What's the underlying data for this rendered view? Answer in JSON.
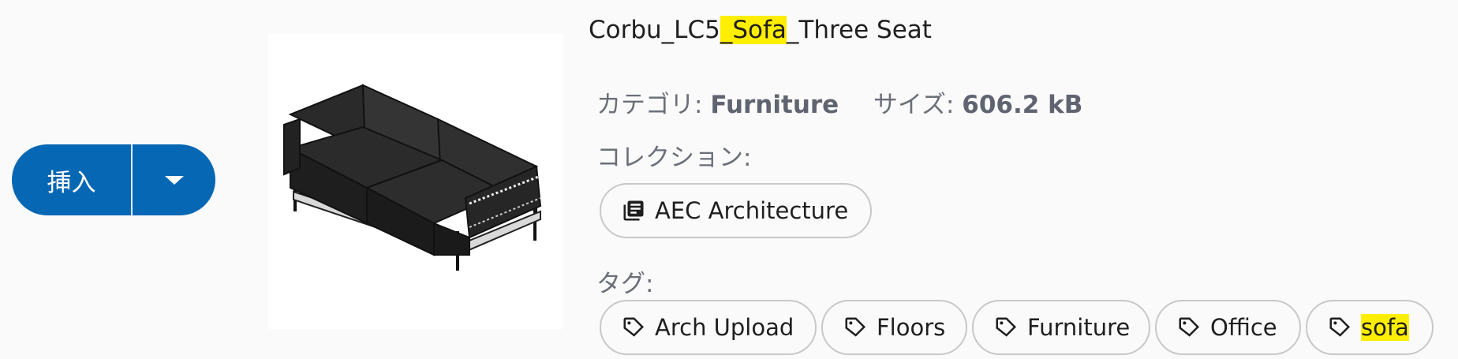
{
  "insert_button": {
    "label": "挿入"
  },
  "asset": {
    "title_prefix": "Corbu_LC5",
    "title_highlight": "_Sofa",
    "title_suffix": "_Three Seat",
    "category_label": "カテゴリ:",
    "category_value": "Furniture",
    "size_label": "サイズ:",
    "size_value": "606.2 kB",
    "collection_label": "コレクション:",
    "tags_label": "タグ:"
  },
  "collections": [
    {
      "label": "AEC Architecture",
      "icon": "library-books-icon"
    }
  ],
  "tags": [
    {
      "label": "Arch Upload",
      "icon": "tag-icon",
      "highlighted": false
    },
    {
      "label": "Floors",
      "icon": "tag-icon",
      "highlighted": false
    },
    {
      "label": "Furniture",
      "icon": "tag-icon",
      "highlighted": false
    },
    {
      "label": "Office",
      "icon": "tag-icon",
      "highlighted": false
    },
    {
      "label": "sofa",
      "icon": "tag-icon",
      "highlighted": true
    }
  ],
  "colors": {
    "primary_button": "#0668b4",
    "highlight": "#ffee00",
    "meta_text": "#6b6f78",
    "chip_border": "#c8c8c8"
  }
}
